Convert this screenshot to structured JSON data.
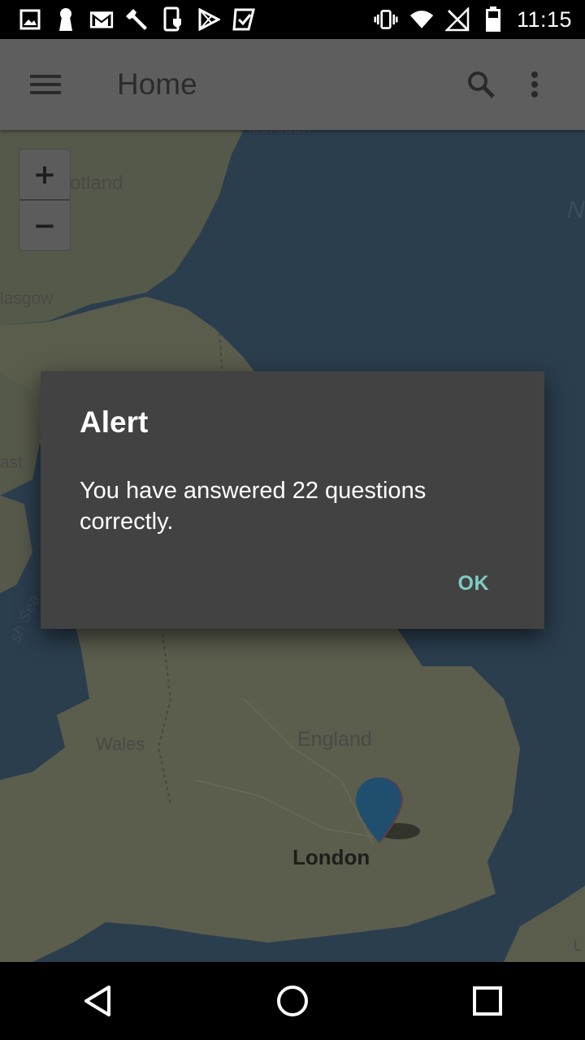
{
  "status_bar": {
    "time": "11:15",
    "left_icons": [
      "image-icon",
      "keyhole-icon",
      "gmail-icon",
      "wrench-icon",
      "phone-shield-icon",
      "play-store-icon",
      "check-flag-icon"
    ],
    "right_icons": [
      "vibrate-icon",
      "wifi-icon",
      "no-signal-icon",
      "battery-icon"
    ]
  },
  "app_bar": {
    "title": "Home",
    "icons": [
      "hamburger-menu-icon",
      "search-icon",
      "more-vert-icon"
    ]
  },
  "map": {
    "zoom_in_label": "+",
    "zoom_out_label": "−",
    "labels": {
      "aberdeen": "Aberdeen",
      "scotland": "otland",
      "glasgow": "lasgow",
      "belfast": "ast",
      "irish_sea": "sh Sea",
      "wales": "Wales",
      "england": "England",
      "london": "London",
      "north_edge": "N",
      "lille_edge": "L"
    },
    "colors": {
      "sea": "#2b3e4e",
      "land": "#5b5d4d",
      "marker": "#1f4e6e"
    }
  },
  "dialog": {
    "title": "Alert",
    "message": "You have answered 22 questions correctly.",
    "ok_label": "OK",
    "accent": "#7fcbc4"
  },
  "nav_bar": {
    "icons": [
      "back-icon",
      "home-icon",
      "recents-icon"
    ]
  }
}
